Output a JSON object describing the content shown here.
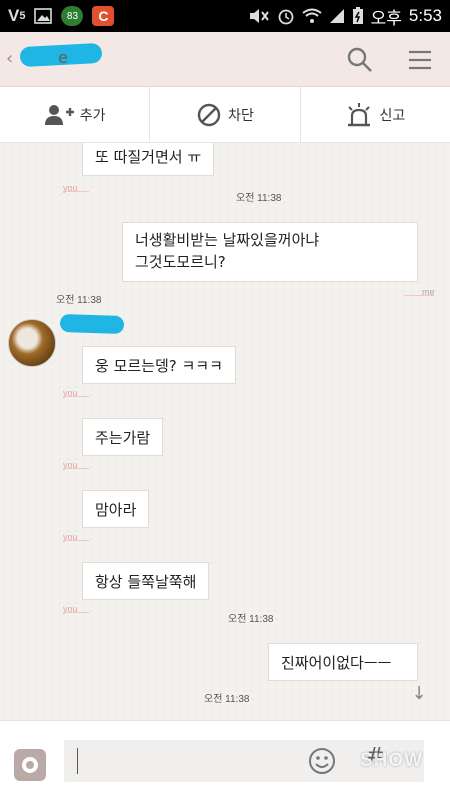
{
  "status_bar": {
    "badge": "83",
    "c_icon": "C",
    "ampm": "오후",
    "time": "5:53"
  },
  "header": {
    "title_fragment": "e"
  },
  "actions": [
    {
      "label": "추가",
      "icon": "add-friend-icon"
    },
    {
      "label": "차단",
      "icon": "block-icon"
    },
    {
      "label": "신고",
      "icon": "report-icon"
    }
  ],
  "messages": [
    {
      "side": "you",
      "text": "또 따질거면서 ㅠ",
      "tag": "you"
    },
    {
      "side": "meta",
      "time": "오전 11:38"
    },
    {
      "side": "me",
      "lines": [
        "너생활비받는 날짜있을꺼아냐",
        "그것도모르니?"
      ],
      "tag": "me",
      "time": "오전 11:38"
    },
    {
      "side": "you",
      "text": "웅 모르는뎅? ㅋㅋㅋ",
      "tag": "you"
    },
    {
      "side": "you",
      "text": "주는가람",
      "tag": "you"
    },
    {
      "side": "you",
      "text": "맘아라",
      "tag": "you"
    },
    {
      "side": "you",
      "text": "항상 들쭉날쭉해",
      "tag": "you",
      "time": "오전 11:38"
    },
    {
      "side": "me",
      "text": "진짜어이없다ㅡㅡ",
      "time": "오전 11:38"
    }
  ],
  "input": {
    "placeholder": "",
    "hash": "#",
    "watermark": "SHOW"
  },
  "colors": {
    "header_bg": "#f4e8e6",
    "chat_bg": "#f3f1ee",
    "you_tag": "#e6a3a3",
    "scribble": "#1fb6e6"
  }
}
